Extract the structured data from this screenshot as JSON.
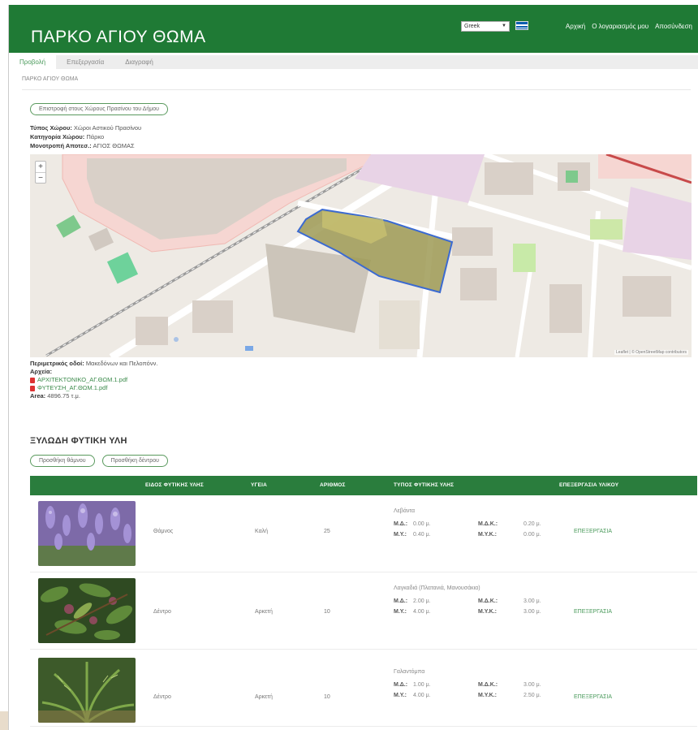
{
  "header": {
    "site_title": "ΠΑΡΚΟ ΑΓΙΟΥ ΘΩΜΑ",
    "language": "Greek",
    "nav": [
      "Αρχική",
      "Ο λογαριασμός μου",
      "Αποσύνδεση"
    ]
  },
  "tabs": [
    {
      "label": "Προβολή",
      "active": true
    },
    {
      "label": "Επεξεργασία",
      "active": false
    },
    {
      "label": "Διαγραφή",
      "active": false
    }
  ],
  "breadcrumb": "ΠΑΡΚΟ ΑΓΙΟΥ ΘΩΜΑ",
  "return_button": "Επιστροφή στους Χώρους Πρασίνου του Δήμου",
  "info": [
    {
      "label": "Τύπος Χώρου:",
      "value": "Χώροι Αστικού Πρασίνου"
    },
    {
      "label": "Κατηγορία Χώρου:",
      "value": "Πάρκο"
    },
    {
      "label": "Μονοτροπή Αποτεσ.:",
      "value": "ΑΓΙΟΣ ΘΩΜΑΣ"
    }
  ],
  "map": {
    "attribution": "Leaflet | © OpenStreetMap contributors"
  },
  "details": {
    "surrounding_label": "Περιμετρικός οδοί:",
    "surrounding_value": "Μακεδόνων και Πελοπόνν.",
    "files_label": "Αρχεία:",
    "files": [
      "ΑΡΧΙΤΕΚΤΟΝΙΚΟ_ΑΓ.ΘΩΜ.1.pdf",
      "ΦΥΤΕΥΣΗ_ΑΓ.ΘΩΜ.1.pdf"
    ],
    "area_label": "Area:",
    "area_value": "4896.75 τ.μ."
  },
  "section": {
    "title": "ΞΥΛΩΔΗ ΦΥΤΙΚΗ ΥΛΗ",
    "add_shrub": "Προσθήκη θάμνου",
    "add_tree": "Προσθήκη δέντρου"
  },
  "table": {
    "headers": [
      "ΕΙΔΟΣ ΦΥΤΙΚΗΣ ΥΛΗΣ",
      "ΥΓΕΙΑ",
      "ΑΡΙΘΜΟΣ",
      "ΤΥΠΟΣ ΦΥΤΙΚΗΣ ΥΛΗΣ",
      "ΕΠΕΞΕΡΓΑΣΙΑ ΥΛΙΚΟΥ"
    ],
    "dim_labels": {
      "md": "Μ.Δ.:",
      "mdk": "Μ.Δ.Κ.:",
      "my": "Μ.Υ.:",
      "myk": "Μ.Υ.Κ.:"
    },
    "rows": [
      {
        "image": "lavender",
        "species": "Θάμνος",
        "health": "Καλή",
        "count": "25",
        "type": "Λεβάντα",
        "md": "0.00 μ.",
        "mdk": "0.20 μ.",
        "my": "0.40 μ.",
        "myk": "0.00 μ.",
        "edit": "ΕΠΕΞΕΡΓΑΣΙΑ"
      },
      {
        "image": "tree-fruit",
        "species": "Δέντρο",
        "health": "Αρκετή",
        "count": "10",
        "type": "Λαγκαδιά (Πλατανιά, Μανουσάκια)",
        "md": "2.00 μ.",
        "mdk": "3.00 μ.",
        "my": "4.00 μ.",
        "myk": "3.00 μ.",
        "edit": "ΕΠΕΞΕΡΓΑΣΙΑ"
      },
      {
        "image": "fern-tree",
        "species": "Δέντρο",
        "health": "Αρκετή",
        "count": "10",
        "type": "Γαλαντόμπα",
        "md": "1.00 μ.",
        "mdk": "3.00 μ.",
        "my": "4.00 μ.",
        "myk": "2.50 μ.",
        "edit": "ΕΠΕΞΕΡΓΑΣΙΑ"
      }
    ]
  }
}
